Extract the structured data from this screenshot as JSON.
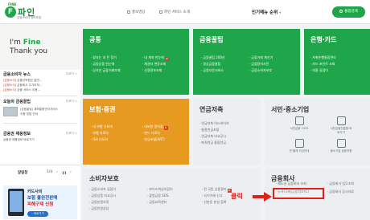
{
  "header": {
    "logo_small": "FINE",
    "logo_mark": "F",
    "logo_name": "파인",
    "logo_sub": "금융소비자 정보포털",
    "nav": [
      "홍보영상",
      "파인 서비스 소개"
    ],
    "popular": "인기메뉴 순위",
    "search_label": "통합검색"
  },
  "hero": {
    "line1_prefix": "I'm ",
    "line1_brand": "Fine",
    "line2": "Thank you"
  },
  "news": {
    "title": "금융소비자 뉴스",
    "more": "더보기 +",
    "items": [
      {
        "tag": "[금융소식]",
        "text": "금융감독원은 일반..."
      },
      {
        "tag": "[금융소식]",
        "text": "금융회사 주가조작..."
      },
      {
        "tag": "[금융소식]",
        "text": "금융 서비스 이용..."
      }
    ]
  },
  "tips": {
    "title": "오늘의 금융꿀팁",
    "more": "더보기 +",
    "text1": "(금융꿀팁) 계좌통합관리서비스",
    "text2": "이용 방법 안내"
  },
  "recruit": {
    "title": "금융권 채용정보",
    "more": "더보기 +",
    "text": "금융권 채용정보 바로가기"
  },
  "app": {
    "title": "알림창",
    "page": "1/4",
    "ctrl_prev": "‹",
    "ctrl_pause": "❚❚",
    "ctrl_next": "›"
  },
  "banner": {
    "line1": "카드사의",
    "line2": "보험 불완전판매",
    "line3": "피해구제 신청",
    "button": "› 바로가기"
  },
  "tiles": {
    "gongtong": {
      "title": "공통",
      "col1": [
        "잠자는 내 돈 찾기",
        "금융상품 한눈에",
        "상속인 금융거래조회"
      ],
      "col2": [
        "내 계좌 한눈에",
        "채권자 변동조회",
        "신용정보조회"
      ]
    },
    "kkultip": {
      "title": "금융꿀팁",
      "col1": [
        "금융꿀팁 200선",
        "영상금융꿀팁",
        "금융자문서비스"
      ],
      "col2": [
        "금융거래 계산기",
        "금융용어사전",
        "금융소비자보호"
      ]
    },
    "bank": {
      "title": "은행·카드",
      "col1": [
        "저축은행통합관리",
        "카드 포인트 조회",
        "외환 길잡이"
      ]
    },
    "insurance": {
      "title": "보험·증권",
      "col1": [
        "내 보험 다보여",
        "보험 다모아",
        "ISA 다모아"
      ],
      "col2": [
        "내보험 찾아줌",
        "펀드 다모아",
        "연금포털(ART)"
      ]
    },
    "pension": {
      "title": "연금저축",
      "items": [
        "연금저축 어드바이저",
        "통합연금포털",
        "연금저축 비교공시",
        "퇴직연금 통합연금"
      ]
    },
    "sme": {
      "title": "서민·중소기업",
      "icons": [
        "서민금융 1332",
        "서민금융진흥원 바로가기",
        "전·월세 자금안내",
        "중소기업 금융지원"
      ]
    },
    "consumer": {
      "title": "소비자보호",
      "col1": [
        "금융소비자 길잡이",
        "금융상품 비교공시",
        "금융분쟁조정",
        "금융민원상담"
      ],
      "col2": [
        "보이스피싱지킴이",
        "불법금융 SOS",
        "금융교육센터"
      ],
      "col3": [
        "전 국민 신용관리",
        "사기거래 신고",
        "신분증 분실 등록"
      ]
    },
    "company": {
      "title": "금융회사",
      "col1": [
        "제도권 금융회사 조회",
        "뉴욕(국제)금융정보(G)"
      ],
      "col2": [
        "금융회사 업무조회",
        "금융회사 공시자료"
      ]
    }
  },
  "annotation": {
    "label": "클릭"
  },
  "colors": {
    "green": "#1fa64a",
    "orange": "#e69a1f",
    "red": "#e0201a"
  }
}
